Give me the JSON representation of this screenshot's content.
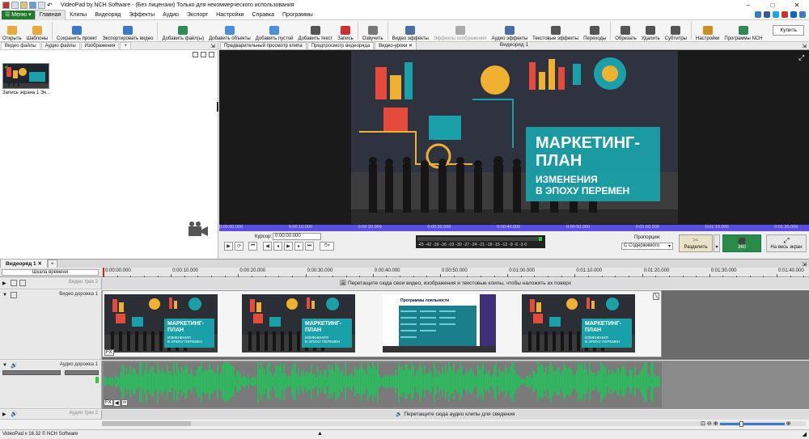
{
  "title": "VideoPad by NCH Software - (Без лицензии) Только для некоммерческого использования",
  "menu": {
    "menu_button": "Меню",
    "items": [
      "Главная",
      "Клипы",
      "Видеоряд",
      "Эффекты",
      "Аудио",
      "Экспорт",
      "Настройки",
      "Справка",
      "Программы"
    ]
  },
  "toolbar": {
    "buttons": [
      {
        "label": "Открыть",
        "icon": "folder-open-icon",
        "color": "#e6a93a"
      },
      {
        "label": "Шаблоны",
        "icon": "templates-icon",
        "color": "#e6a93a"
      },
      {
        "label": "Сохранить проект",
        "icon": "save-icon",
        "color": "#3b79c9"
      },
      {
        "label": "Экспортировать видео",
        "icon": "export-icon",
        "color": "#3b79c9"
      },
      {
        "label": "Добавить файл(ы)",
        "icon": "add-file-icon",
        "color": "#2e8b57"
      },
      {
        "label": "Добавить объекты",
        "icon": "add-objects-icon",
        "color": "#4a90d9"
      },
      {
        "label": "Добавить пустой",
        "icon": "add-blank-icon",
        "color": "#4a90d9"
      },
      {
        "label": "Добавить текст",
        "icon": "add-text-icon",
        "color": "#555555"
      },
      {
        "label": "Запись",
        "icon": "record-icon",
        "color": "#d03030"
      },
      {
        "label": "Озвучить",
        "icon": "narrate-icon",
        "color": "#777777"
      },
      {
        "label": "Видео эффекты",
        "icon": "video-effects-icon",
        "color": "#4a6fa5"
      },
      {
        "label": "Эффекты изображения",
        "icon": "image-effects-icon",
        "color": "#aaaaaa"
      },
      {
        "label": "Аудио эффекты",
        "icon": "audio-effects-icon",
        "color": "#4a6fa5"
      },
      {
        "label": "Текстовые эффекты",
        "icon": "text-effects-icon",
        "color": "#555555"
      },
      {
        "label": "Переходы",
        "icon": "transitions-icon",
        "color": "#555555"
      },
      {
        "label": "Обрезать",
        "icon": "crop-icon",
        "color": "#555555"
      },
      {
        "label": "Удалить",
        "icon": "delete-icon",
        "color": "#555555"
      },
      {
        "label": "Субтитры",
        "icon": "subtitles-icon",
        "color": "#555555"
      },
      {
        "label": "Настройки",
        "icon": "settings-icon",
        "color": "#c79020"
      },
      {
        "label": "Программы NCH",
        "icon": "nch-suite-icon",
        "color": "#2e8b57"
      }
    ],
    "buy_label": "Купить"
  },
  "media": {
    "tabs": [
      "Видео файлы",
      "Аудио файлы",
      "Изображения"
    ],
    "add_tab": "+",
    "clip_name": "Запись экрана 1 Эк..."
  },
  "preview": {
    "tabs": [
      "Предварительный просмотр клипа",
      "Предпросмотр видеоряда",
      "Видео-уроки"
    ],
    "sequence_label": "Видеоряд 1",
    "slide": {
      "title_line1": "МАРКЕТИНГ-",
      "title_line2": "ПЛАН",
      "subtitle_line1": "ИЗМЕНЕНИЯ",
      "subtitle_line2": "В ЭПОХУ ПЕРЕМЕН"
    },
    "timecodes": [
      "0:00:00.000",
      "0:00:10.000",
      "0:00:20.000",
      "0:00:30.000",
      "0:00:40.000",
      "0:00:50.000",
      "0:01:00.000",
      "0:01:10.000",
      "0:01:20.000"
    ],
    "cursor_label": "Курсор:",
    "cursor_value": "0:00:00.000",
    "meter_scale": "-45 -42 -39 -36 -33 -30 -27 -24 -21 -18 -15 -12 -9 -6 -3 0",
    "proportions_label": "Пропорции:",
    "proportions_value": "С Содержимого",
    "split_label": "Разделить",
    "vr_label": "360",
    "fullscreen_label": "На весь экран"
  },
  "timeline": {
    "sequence_tab": "Видеоряд 1",
    "add_tab": "+",
    "scale_label": "Шкала времени",
    "ruler": [
      "0:00:00.000",
      "0:00:10.000",
      "0:00:20.000",
      "0:00:30.000",
      "0:00:40.000",
      "0:00:50.000",
      "0:01:00.000",
      "0:01:10.000",
      "0:01:20.000",
      "0:01:30.000",
      "0:01:40.000"
    ],
    "video_track2": "Видео трек 2",
    "video_overlay_hint": "Перетащите сюда свои видео, изображения и текстовые клипы, чтобы наложить их поверх",
    "video_track1": "Видео дорожка 1",
    "audio_track1": "Аудио дорожка 1",
    "audio_track2": "Аудио трек 2",
    "audio_hint": "Перетащите сюда аудио клипы для сведения",
    "clip_slide": {
      "title_line1": "МАРКЕТИНГ-",
      "title_line2": "ПЛАН",
      "subtitle_line1": "ИЗМЕНЕНИЯ",
      "subtitle_line2": "В ЭПОХУ ПЕРЕМЕН"
    },
    "table_slide_title": "Программы лояльности"
  },
  "status": {
    "version": "VideoPad v 16.32 © NCH Software"
  },
  "colors": {
    "accent_green": "#1f7a2a",
    "timeline_blue": "#5b4de0",
    "waveform": "#22c25a",
    "slide_teal": "#1aa0a8"
  }
}
